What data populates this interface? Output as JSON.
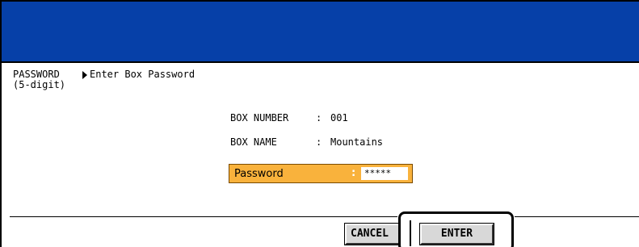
{
  "header": {
    "color": "#0640a8"
  },
  "prompt": {
    "label": "PASSWORD",
    "sublabel": "(5-digit)",
    "instruction": "Enter Box Password",
    "instruction_icon": "right-triangle-icon"
  },
  "box": {
    "number_label": "BOX NUMBER",
    "number_sep": ":",
    "number_value": "001",
    "name_label": "BOX NAME",
    "name_sep": ":",
    "name_value": "Mountains"
  },
  "password_field": {
    "label": "Password",
    "sep": ":",
    "value": "*****",
    "color": "#f9b23c"
  },
  "buttons": {
    "cancel_label": "CANCEL",
    "enter_label": "ENTER"
  }
}
